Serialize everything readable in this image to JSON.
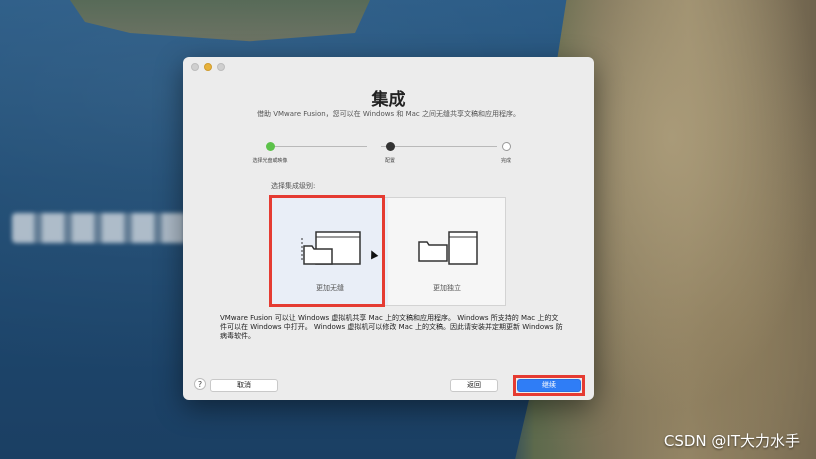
{
  "dialog": {
    "title": "集成",
    "subtitle": "借助 VMware Fusion，您可以在 Windows 和 Mac 之间无缝共享文稿和应用程序。",
    "steps": [
      {
        "label": "选择光盘或映像",
        "state": "done"
      },
      {
        "label": "配置",
        "state": "current"
      },
      {
        "label": "完成",
        "state": "pending"
      }
    ],
    "level_label": "选择集成级别:",
    "options": [
      {
        "label": "更加无缝",
        "selected": true,
        "icon": "seamless-windows-icon"
      },
      {
        "label": "更加独立",
        "selected": false,
        "icon": "isolated-windows-icon"
      }
    ],
    "description": "VMware Fusion 可以让 Windows 虚拟机共享 Mac 上的文稿和应用程序。 Windows 所支持的 Mac 上的文件可以在 Windows 中打开。 Windows 虚拟机可以修改 Mac 上的文稿。因此请安装并定期更新 Windows 防病毒软件。",
    "buttons": {
      "help": "?",
      "cancel": "取消",
      "back": "返回",
      "continue": "继续"
    }
  },
  "watermark": "CSDN @IT大力水手",
  "colors": {
    "accent": "#2f7df6",
    "highlight": "#e53b32",
    "step_done": "#5cc24a"
  }
}
